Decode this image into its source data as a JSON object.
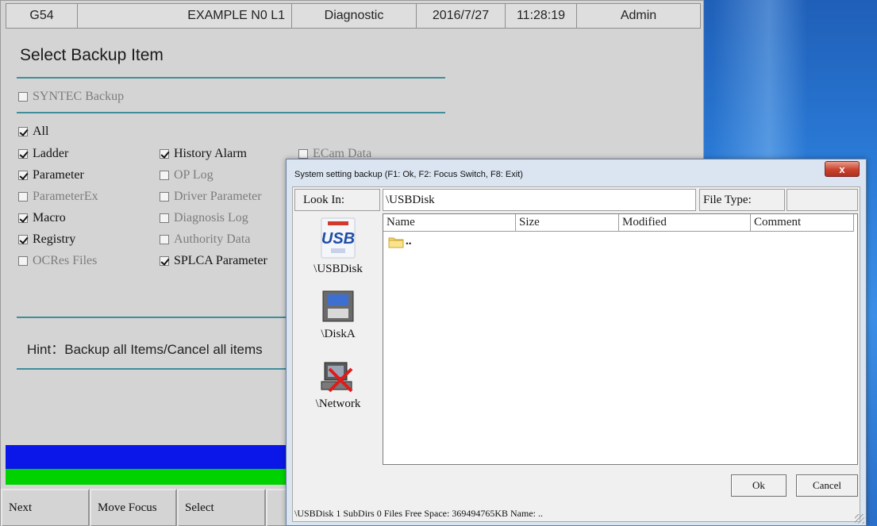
{
  "status_bar": {
    "coord": "G54",
    "program": "EXAMPLE N0 L1",
    "mode": "Diagnostic",
    "date": "2016/7/27",
    "time": "11:28:19",
    "user": "Admin"
  },
  "panel": {
    "title": "Select Backup Item",
    "syntec_backup": {
      "label": "SYNTEC Backup",
      "checked": false,
      "enabled": false
    },
    "all": {
      "label": "All",
      "checked": true
    },
    "items_col1": [
      {
        "label": "Ladder",
        "checked": true,
        "enabled": true
      },
      {
        "label": "Parameter",
        "checked": true,
        "enabled": true
      },
      {
        "label": "ParameterEx",
        "checked": false,
        "enabled": false
      },
      {
        "label": "Macro",
        "checked": true,
        "enabled": true
      },
      {
        "label": "Registry",
        "checked": true,
        "enabled": true
      },
      {
        "label": "OCRes Files",
        "checked": false,
        "enabled": false
      }
    ],
    "items_col2": [
      {
        "label": "History Alarm",
        "checked": true,
        "enabled": true
      },
      {
        "label": "OP Log",
        "checked": false,
        "enabled": false
      },
      {
        "label": "Driver Parameter",
        "checked": false,
        "enabled": false
      },
      {
        "label": "Diagnosis Log",
        "checked": false,
        "enabled": false
      },
      {
        "label": "Authority Data",
        "checked": false,
        "enabled": false
      },
      {
        "label": "SPLCA Parameter",
        "checked": true,
        "enabled": true
      }
    ],
    "items_col3": [
      {
        "label": "ECam Data",
        "checked": false,
        "enabled": false
      }
    ],
    "hint": "Hint：Backup all Items/Cancel all items"
  },
  "softkeys": [
    "Next",
    "Move Focus",
    "Select"
  ],
  "dialog": {
    "title": "System setting backup (F1: Ok, F2: Focus Switch, F8: Exit)",
    "close_label": "x",
    "look_in_label": "Look In:",
    "look_in_value": "\\USBDisk",
    "file_type_label": "File Type:",
    "file_type_value": "",
    "drives": [
      {
        "label": "\\USBDisk",
        "icon": "usb-drive-icon"
      },
      {
        "label": "\\DiskA",
        "icon": "disk-icon"
      },
      {
        "label": "\\Network",
        "icon": "network-drive-disconnected-icon"
      }
    ],
    "columns": [
      "Name",
      "Size",
      "Modified",
      "Comment"
    ],
    "rows": [
      {
        "name": "..",
        "icon": "folder-icon"
      }
    ],
    "ok_label": "Ok",
    "cancel_label": "Cancel",
    "status": "\\USBDisk 1 SubDirs 0 Files Free Space: 369494765KB  Name: .."
  },
  "colors": {
    "accent_rule": "#3f8e99",
    "bar_blue": "#0a17e8",
    "bar_green": "#00d200",
    "desktop": "#2a7ad6",
    "close_button": "#c7432d"
  }
}
